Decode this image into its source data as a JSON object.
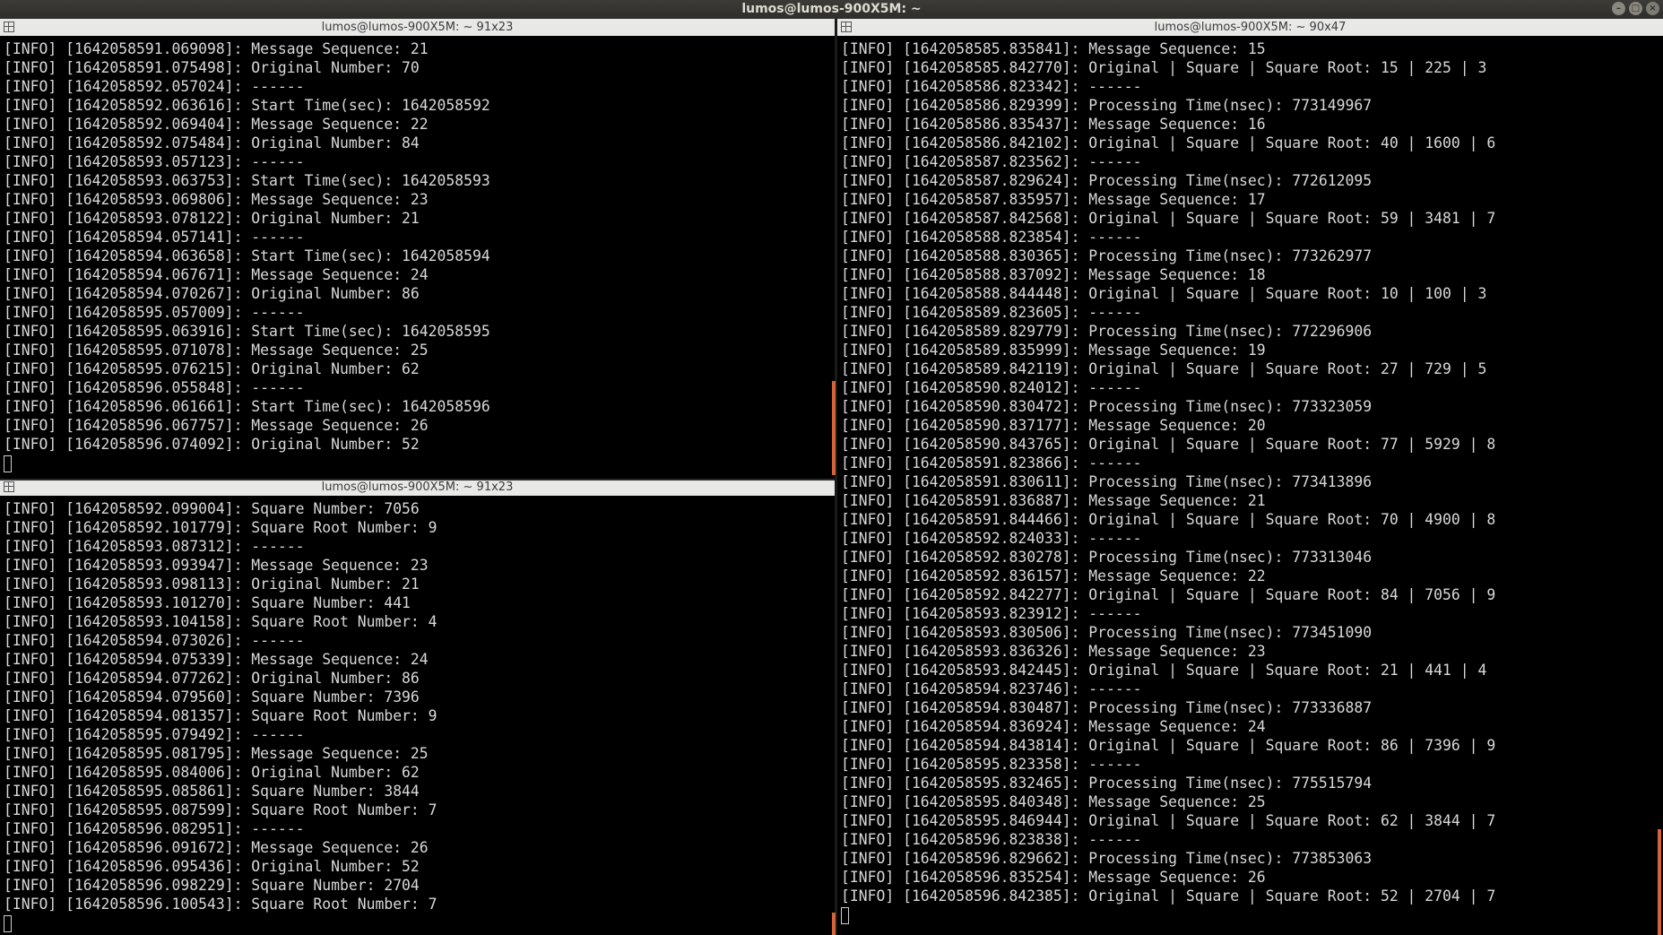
{
  "window": {
    "title": "lumos@lumos-900X5M: ~"
  },
  "panes": {
    "top_left": {
      "title": "lumos@lumos-900X5M: ~ 91x23",
      "lines": [
        "[INFO] [1642058591.069098]: Message Sequence: 21",
        "[INFO] [1642058591.075498]: Original Number: 70",
        "[INFO] [1642058592.057024]: ------",
        "[INFO] [1642058592.063616]: Start Time(sec): 1642058592",
        "[INFO] [1642058592.069404]: Message Sequence: 22",
        "[INFO] [1642058592.075484]: Original Number: 84",
        "[INFO] [1642058593.057123]: ------",
        "[INFO] [1642058593.063753]: Start Time(sec): 1642058593",
        "[INFO] [1642058593.069806]: Message Sequence: 23",
        "[INFO] [1642058593.078122]: Original Number: 21",
        "[INFO] [1642058594.057141]: ------",
        "[INFO] [1642058594.063658]: Start Time(sec): 1642058594",
        "[INFO] [1642058594.067671]: Message Sequence: 24",
        "[INFO] [1642058594.070267]: Original Number: 86",
        "[INFO] [1642058595.057009]: ------",
        "[INFO] [1642058595.063916]: Start Time(sec): 1642058595",
        "[INFO] [1642058595.071078]: Message Sequence: 25",
        "[INFO] [1642058595.076215]: Original Number: 62",
        "[INFO] [1642058596.055848]: ------",
        "[INFO] [1642058596.061661]: Start Time(sec): 1642058596",
        "[INFO] [1642058596.067757]: Message Sequence: 26",
        "[INFO] [1642058596.074092]: Original Number: 52"
      ]
    },
    "bottom_left": {
      "title": "lumos@lumos-900X5M: ~ 91x23",
      "lines": [
        "[INFO] [1642058592.099004]: Square Number: 7056",
        "[INFO] [1642058592.101779]: Square Root Number: 9",
        "[INFO] [1642058593.087312]: ------",
        "[INFO] [1642058593.093947]: Message Sequence: 23",
        "[INFO] [1642058593.098113]: Original Number: 21",
        "[INFO] [1642058593.101270]: Square Number: 441",
        "[INFO] [1642058593.104158]: Square Root Number: 4",
        "[INFO] [1642058594.073026]: ------",
        "[INFO] [1642058594.075339]: Message Sequence: 24",
        "[INFO] [1642058594.077262]: Original Number: 86",
        "[INFO] [1642058594.079560]: Square Number: 7396",
        "[INFO] [1642058594.081357]: Square Root Number: 9",
        "[INFO] [1642058595.079492]: ------",
        "[INFO] [1642058595.081795]: Message Sequence: 25",
        "[INFO] [1642058595.084006]: Original Number: 62",
        "[INFO] [1642058595.085861]: Square Number: 3844",
        "[INFO] [1642058595.087599]: Square Root Number: 7",
        "[INFO] [1642058596.082951]: ------",
        "[INFO] [1642058596.091672]: Message Sequence: 26",
        "[INFO] [1642058596.095436]: Original Number: 52",
        "[INFO] [1642058596.098229]: Square Number: 2704",
        "[INFO] [1642058596.100543]: Square Root Number: 7"
      ]
    },
    "right": {
      "title": "lumos@lumos-900X5M: ~ 90x47",
      "lines": [
        "[INFO] [1642058585.835841]: Message Sequence: 15",
        "[INFO] [1642058585.842770]: Original | Square | Square Root: 15 | 225 | 3",
        "[INFO] [1642058586.823342]: ------",
        "[INFO] [1642058586.829399]: Processing Time(nsec): 773149967",
        "[INFO] [1642058586.835437]: Message Sequence: 16",
        "[INFO] [1642058586.842102]: Original | Square | Square Root: 40 | 1600 | 6",
        "[INFO] [1642058587.823562]: ------",
        "[INFO] [1642058587.829624]: Processing Time(nsec): 772612095",
        "[INFO] [1642058587.835957]: Message Sequence: 17",
        "[INFO] [1642058587.842568]: Original | Square | Square Root: 59 | 3481 | 7",
        "[INFO] [1642058588.823854]: ------",
        "[INFO] [1642058588.830365]: Processing Time(nsec): 773262977",
        "[INFO] [1642058588.837092]: Message Sequence: 18",
        "[INFO] [1642058588.844448]: Original | Square | Square Root: 10 | 100 | 3",
        "[INFO] [1642058589.823605]: ------",
        "[INFO] [1642058589.829779]: Processing Time(nsec): 772296906",
        "[INFO] [1642058589.835999]: Message Sequence: 19",
        "[INFO] [1642058589.842119]: Original | Square | Square Root: 27 | 729 | 5",
        "[INFO] [1642058590.824012]: ------",
        "[INFO] [1642058590.830472]: Processing Time(nsec): 773323059",
        "[INFO] [1642058590.837177]: Message Sequence: 20",
        "[INFO] [1642058590.843765]: Original | Square | Square Root: 77 | 5929 | 8",
        "[INFO] [1642058591.823866]: ------",
        "[INFO] [1642058591.830611]: Processing Time(nsec): 773413896",
        "[INFO] [1642058591.836887]: Message Sequence: 21",
        "[INFO] [1642058591.844466]: Original | Square | Square Root: 70 | 4900 | 8",
        "[INFO] [1642058592.824033]: ------",
        "[INFO] [1642058592.830278]: Processing Time(nsec): 773313046",
        "[INFO] [1642058592.836157]: Message Sequence: 22",
        "[INFO] [1642058592.842277]: Original | Square | Square Root: 84 | 7056 | 9",
        "[INFO] [1642058593.823912]: ------",
        "[INFO] [1642058593.830506]: Processing Time(nsec): 773451090",
        "[INFO] [1642058593.836326]: Message Sequence: 23",
        "[INFO] [1642058593.842445]: Original | Square | Square Root: 21 | 441 | 4",
        "[INFO] [1642058594.823746]: ------",
        "[INFO] [1642058594.830487]: Processing Time(nsec): 773336887",
        "[INFO] [1642058594.836924]: Message Sequence: 24",
        "[INFO] [1642058594.843814]: Original | Square | Square Root: 86 | 7396 | 9",
        "[INFO] [1642058595.823358]: ------",
        "[INFO] [1642058595.832465]: Processing Time(nsec): 775515794",
        "[INFO] [1642058595.840348]: Message Sequence: 25",
        "[INFO] [1642058595.846944]: Original | Square | Square Root: 62 | 3844 | 7",
        "[INFO] [1642058596.823838]: ------",
        "[INFO] [1642058596.829662]: Processing Time(nsec): 773853063",
        "[INFO] [1642058596.835254]: Message Sequence: 26",
        "[INFO] [1642058596.842385]: Original | Square | Square Root: 52 | 2704 | 7"
      ]
    }
  },
  "colors": {
    "terminal_bg": "#000000",
    "terminal_fg": "#d8d8d8",
    "pane_title_bg": "#e8e8e7",
    "window_title_bg": "#3c3b37",
    "scroll_accent": "#d2643a"
  }
}
